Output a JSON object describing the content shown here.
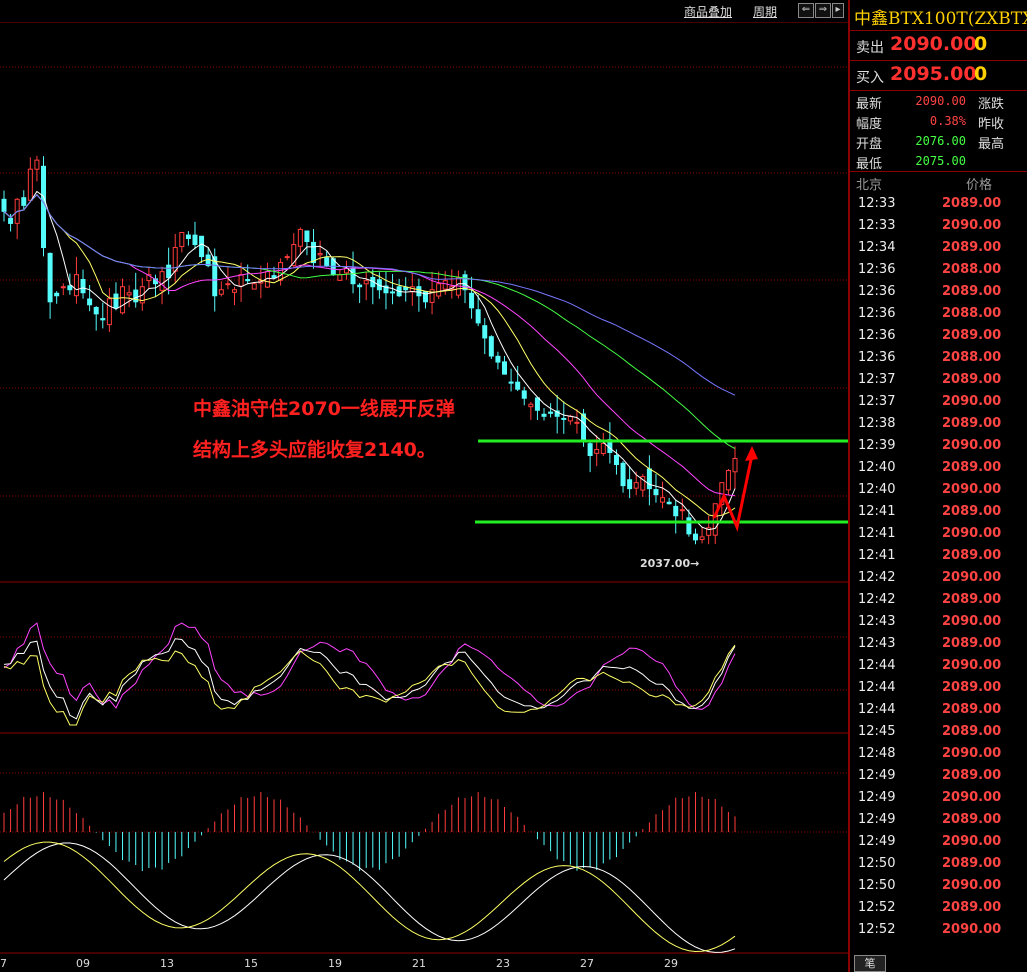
{
  "topbar": {
    "overlay_label": "商品叠加",
    "period_label": "周期"
  },
  "annotations": {
    "line1": "中鑫油守住2070一线展开反弹",
    "line2": "结构上多头应能收复2140。",
    "low_label": "2037.00→"
  },
  "x_axis_labels": [
    "7",
    "09",
    "13",
    "15",
    "19",
    "21",
    "23",
    "27",
    "29"
  ],
  "panel": {
    "title": "中鑫BTX100T(ZXBTX",
    "sell": {
      "label": "卖出",
      "price": "2090.00",
      "volume": "0"
    },
    "buy": {
      "label": "买入",
      "price": "2095.00",
      "volume": "0"
    },
    "stats": [
      {
        "label": "最新",
        "value": "2090.00",
        "label2": "涨跌"
      },
      {
        "label": "幅度",
        "value": "0.38%",
        "label2": "昨收"
      },
      {
        "label": "开盘",
        "value": "2076.00",
        "label2": "最高"
      },
      {
        "label": "最低",
        "value": "2075.00",
        "label2": ""
      }
    ],
    "ticks_header": {
      "time": "北京",
      "price": "价格"
    },
    "ticks": [
      {
        "time": "12:33",
        "price": "2089.00"
      },
      {
        "time": "12:33",
        "price": "2090.00"
      },
      {
        "time": "12:34",
        "price": "2089.00"
      },
      {
        "time": "12:36",
        "price": "2088.00"
      },
      {
        "time": "12:36",
        "price": "2089.00"
      },
      {
        "time": "12:36",
        "price": "2088.00"
      },
      {
        "time": "12:36",
        "price": "2089.00"
      },
      {
        "time": "12:36",
        "price": "2088.00"
      },
      {
        "time": "12:37",
        "price": "2089.00"
      },
      {
        "time": "12:37",
        "price": "2090.00"
      },
      {
        "time": "12:38",
        "price": "2089.00"
      },
      {
        "time": "12:39",
        "price": "2090.00"
      },
      {
        "time": "12:40",
        "price": "2089.00"
      },
      {
        "time": "12:40",
        "price": "2090.00"
      },
      {
        "time": "12:41",
        "price": "2089.00"
      },
      {
        "time": "12:41",
        "price": "2090.00"
      },
      {
        "time": "12:41",
        "price": "2089.00"
      },
      {
        "time": "12:42",
        "price": "2090.00"
      },
      {
        "time": "12:42",
        "price": "2089.00"
      },
      {
        "time": "12:43",
        "price": "2090.00"
      },
      {
        "time": "12:43",
        "price": "2089.00"
      },
      {
        "time": "12:44",
        "price": "2090.00"
      },
      {
        "time": "12:44",
        "price": "2089.00"
      },
      {
        "time": "12:44",
        "price": "2089.00"
      },
      {
        "time": "12:45",
        "price": "2089.00"
      },
      {
        "time": "12:48",
        "price": "2090.00"
      },
      {
        "time": "12:49",
        "price": "2089.00"
      },
      {
        "time": "12:49",
        "price": "2090.00"
      },
      {
        "time": "12:49",
        "price": "2089.00"
      },
      {
        "time": "12:49",
        "price": "2090.00"
      },
      {
        "time": "12:50",
        "price": "2089.00"
      },
      {
        "time": "12:50",
        "price": "2090.00"
      },
      {
        "time": "12:52",
        "price": "2089.00"
      },
      {
        "time": "12:52",
        "price": "2090.00"
      }
    ],
    "tab_label": "笔"
  },
  "colors": {
    "up": "#ff3b3b",
    "down": "#54fcfc",
    "support": "#22ee22",
    "arrow": "#ff0000",
    "grid": "#8b0000"
  },
  "chart_data": {
    "type": "candlestick",
    "closes": [
      2108,
      2104,
      2112,
      2110,
      2122,
      2125,
      2096,
      2078,
      2080,
      2083,
      2082,
      2087,
      2081,
      2077,
      2074,
      2072,
      2079,
      2076,
      2083,
      2081,
      2078,
      2083,
      2087,
      2084,
      2088,
      2086,
      2096,
      2101,
      2099,
      2097,
      2093,
      2090,
      2080,
      2082,
      2084,
      2082,
      2087,
      2085,
      2084,
      2085,
      2088,
      2086,
      2091,
      2093,
      2097,
      2102,
      2098,
      2091,
      2094,
      2090,
      2087,
      2087,
      2089,
      2084,
      2083,
      2085,
      2083,
      2082,
      2081,
      2081,
      2080,
      2082,
      2083,
      2080,
      2078,
      2082,
      2084,
      2085,
      2083,
      2086,
      2082,
      2076,
      2071,
      2066,
      2060,
      2058,
      2054,
      2051,
      2049,
      2046,
      2044,
      2042,
      2040,
      2041,
      2040,
      2039,
      2040,
      2038,
      2032,
      2027,
      2029,
      2031,
      2028,
      2024,
      2017,
      2016,
      2018,
      2020,
      2016,
      2014,
      2013,
      2011,
      2007,
      2009,
      2001,
      1999,
      2000,
      2003,
      2011,
      2018,
      2022,
      2026
    ],
    "low_marker": 2037.0
  }
}
